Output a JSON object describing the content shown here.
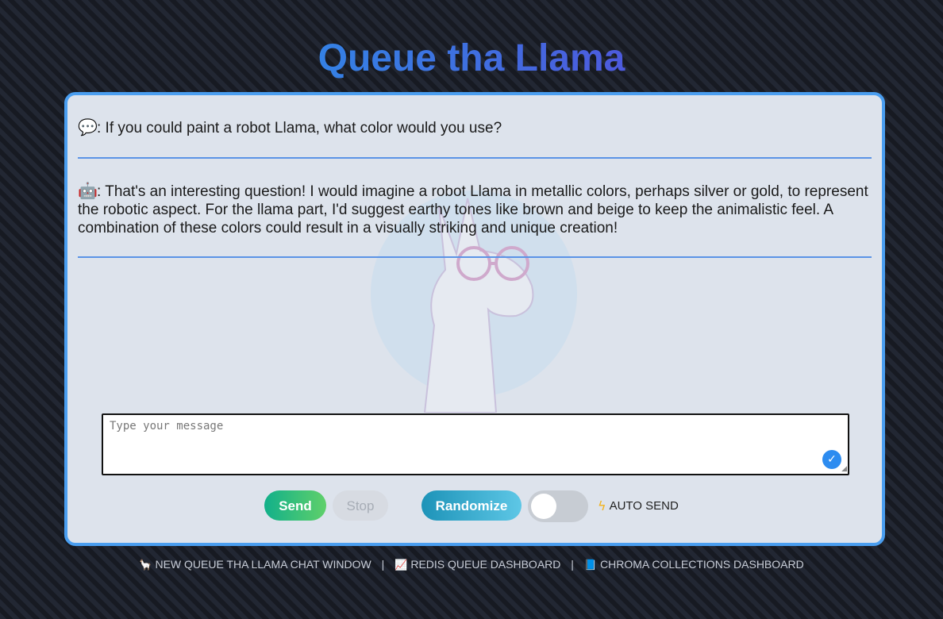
{
  "title": "Queue tha Llama",
  "messages": [
    {
      "role": "user",
      "icon": "speech-balloon-icon",
      "icon_glyph": "💬",
      "text": ": If you could paint a robot Llama, what color would you use?"
    },
    {
      "role": "assistant",
      "icon": "robot-face-icon",
      "icon_glyph": "🤖",
      "text": ": That's an interesting question! I would imagine a robot Llama in metallic colors, perhaps silver or gold, to represent the robotic aspect. For the llama part, I'd suggest earthy tones like brown and beige to keep the animalistic feel. A combination of these colors could result in a visually striking and unique creation!"
    }
  ],
  "input": {
    "placeholder": "Type your message",
    "value": ""
  },
  "controls": {
    "send_label": "Send",
    "stop_label": "Stop",
    "randomize_label": "Randomize",
    "auto_send_label": "AUTO SEND",
    "auto_send_on": false
  },
  "footer": {
    "links": [
      {
        "icon": "llama-icon",
        "label": "NEW QUEUE THA LLAMA CHAT WINDOW"
      },
      {
        "icon": "chart-icon",
        "label": "REDIS QUEUE DASHBOARD"
      },
      {
        "icon": "book-icon",
        "label": "CHROMA COLLECTIONS DASHBOARD"
      }
    ],
    "separator": "|"
  },
  "colors": {
    "accent_border": "#4a9ef0",
    "send_start": "#12b08a",
    "send_end": "#5fd06a",
    "randomize_start": "#1d93b8",
    "randomize_end": "#5ec7e6"
  }
}
